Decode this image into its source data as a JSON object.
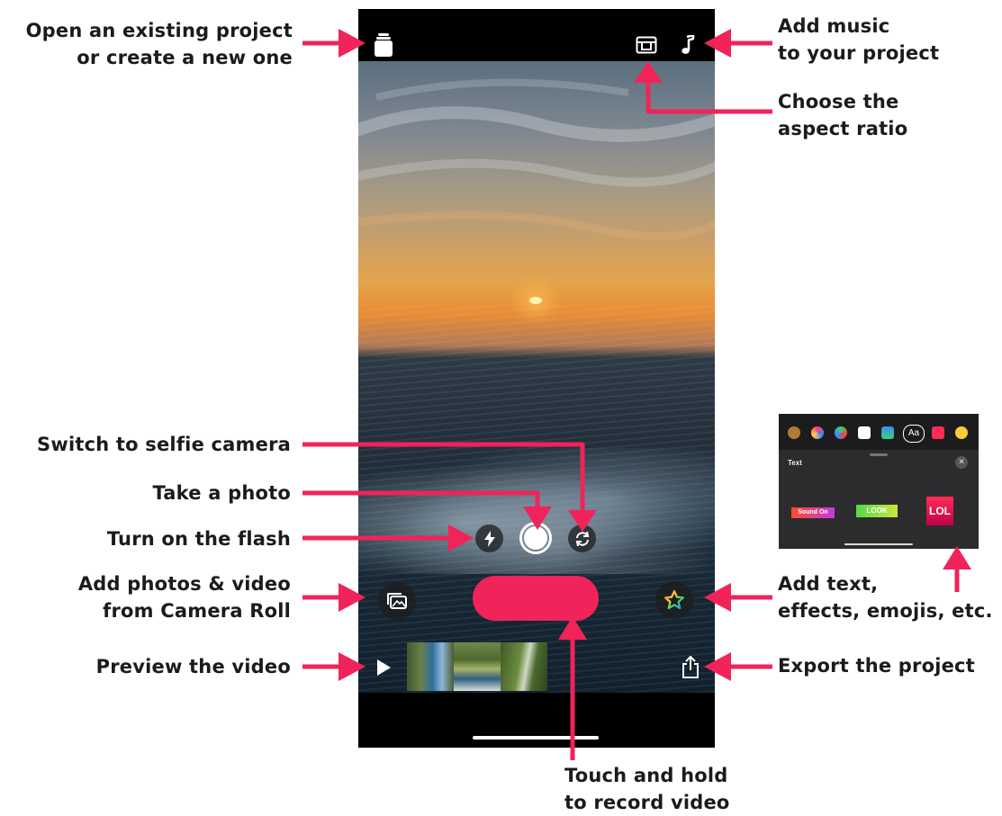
{
  "callouts": {
    "open_project": [
      "Open an existing project",
      "or create a new one"
    ],
    "add_music": [
      "Add music",
      "to your project"
    ],
    "aspect_ratio": [
      "Choose the",
      "aspect ratio"
    ],
    "selfie_camera": "Switch to selfie camera",
    "take_photo": "Take a photo",
    "flash": "Turn on the flash",
    "add_media": [
      "Add photos & video",
      "from Camera Roll"
    ],
    "add_text": [
      "Add text,",
      "effects, emojis, etc."
    ],
    "preview": "Preview the video",
    "export": "Export the project",
    "record": [
      "Touch and hold",
      "to record video"
    ]
  },
  "phone": {
    "icons": {
      "projects": "projects-stack-icon",
      "aspect_ratio": "aspect-ratio-icon",
      "music": "music-note-icon",
      "flash": "flash-icon",
      "shutter": "shutter-icon",
      "flip_camera": "flip-camera-icon",
      "camera_roll": "camera-roll-icon",
      "effects": "star-effects-icon",
      "play": "play-icon",
      "share": "share-icon"
    },
    "colors": {
      "record_button": "#f0245a",
      "annotation_arrow": "#f0245a"
    }
  },
  "effects_panel": {
    "title": "Text",
    "selected_tab": "Aa",
    "styles": [
      "Sound On",
      "LOOK",
      "LOL"
    ]
  }
}
